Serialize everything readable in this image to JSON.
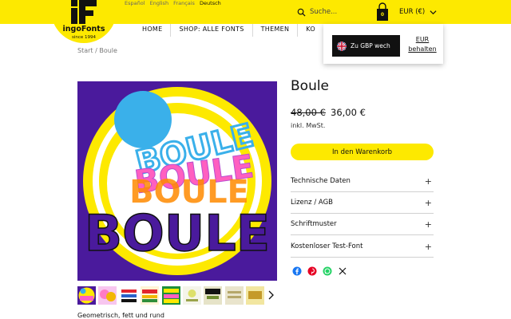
{
  "languages": [
    "Español",
    "English",
    "Français",
    "Deutsch"
  ],
  "brand": {
    "name": "ingoFonts",
    "since": "since 1994"
  },
  "search": {
    "placeholder": "Suche..."
  },
  "cart": {
    "count": "0"
  },
  "currency": {
    "selected": "EUR (€)"
  },
  "nav": [
    "HOME",
    "SHOP: ALLE FONTS",
    "THEMEN",
    "KO"
  ],
  "popup": {
    "switch_label": "Zu GBP wech",
    "keep_label": "EUR behalten"
  },
  "breadcrumb": "Start / Boule",
  "product": {
    "title": "Boule",
    "old_price": "48,00 €",
    "new_price": "36,00 €",
    "tax_note": "inkl. MwSt.",
    "add_to_cart": "In den Warenkorb",
    "tagline": "Geometrisch, fett und rund",
    "image_text": [
      "BOULE",
      "BOULE",
      "BOULE",
      "BOULE"
    ]
  },
  "accordion": [
    "Technische Daten",
    "Lizenz / AGB",
    "Schriftmuster",
    "Kostenloser Test-Font"
  ],
  "share_icons": [
    "facebook-icon",
    "pinterest-icon",
    "whatsapp-icon",
    "x-icon"
  ],
  "colors": {
    "brand_yellow": "#fde900",
    "image_purple": "#4a1a9c",
    "ball_blue": "#3ab0ea"
  }
}
